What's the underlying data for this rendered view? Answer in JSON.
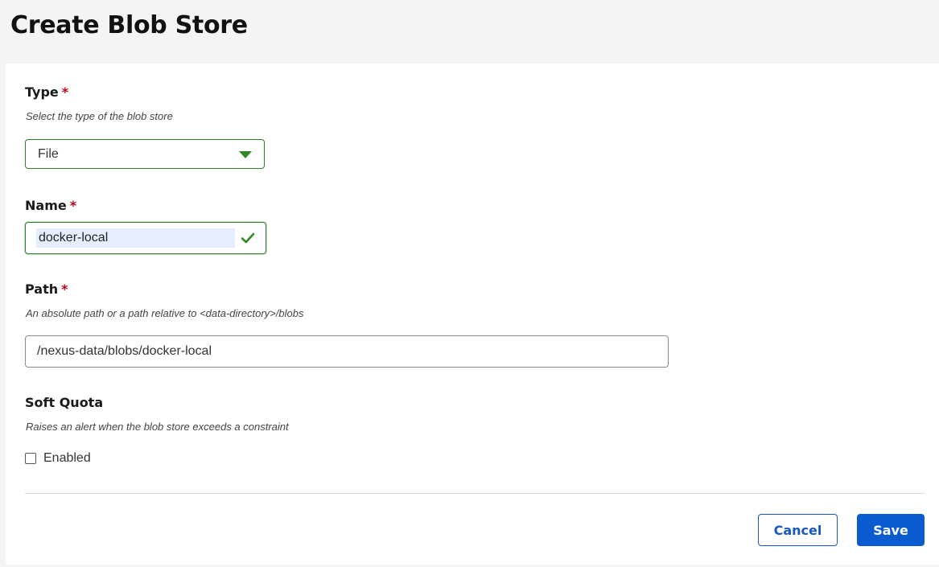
{
  "page": {
    "title": "Create Blob Store"
  },
  "form": {
    "type": {
      "label": "Type",
      "required_mark": "*",
      "description": "Select the type of the blob store",
      "selected": "File"
    },
    "name": {
      "label": "Name",
      "required_mark": "*",
      "value": "docker-local"
    },
    "path": {
      "label": "Path",
      "required_mark": "*",
      "description": "An absolute path or a path relative to <data-directory>/blobs",
      "value": "/nexus-data/blobs/docker-local"
    },
    "soft_quota": {
      "label": "Soft Quota",
      "description": "Raises an alert when the blob store exceeds a constraint",
      "checkbox_label": "Enabled",
      "checked": false
    }
  },
  "actions": {
    "cancel_label": "Cancel",
    "save_label": "Save"
  },
  "icons": {
    "type_dropdown": "caret-down-icon",
    "name_valid": "checkmark-icon"
  },
  "colors": {
    "valid_green": "#2e8b24",
    "primary_blue": "#0a5bd0",
    "required_red": "#c0001a"
  }
}
